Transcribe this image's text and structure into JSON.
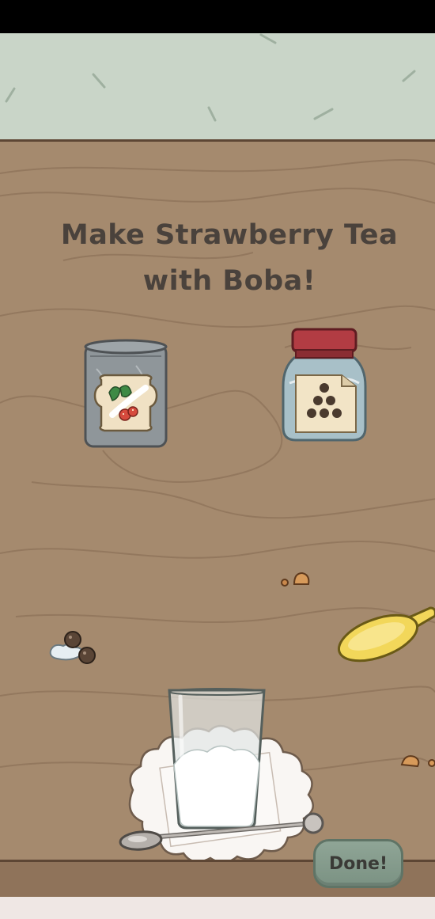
{
  "game": {
    "instruction_line1": "Make Strawberry Tea",
    "instruction_line2": "with Boba!",
    "done_label": "Done!"
  },
  "items": {
    "tea_tin": "strawberry-tea-tin-icon",
    "boba_jar": "boba-jar-icon",
    "scoop": "scoop-icon",
    "glass": "glass-icon",
    "spoon": "spoon-icon"
  },
  "colors": {
    "wall": "#c9d5c8",
    "counter": "#a58a6e",
    "counter_edge": "#5d4634",
    "text": "#4a423c",
    "done_button": "#8fa596",
    "jar_lid": "#b23c43",
    "scoop": "#f2d75a"
  }
}
